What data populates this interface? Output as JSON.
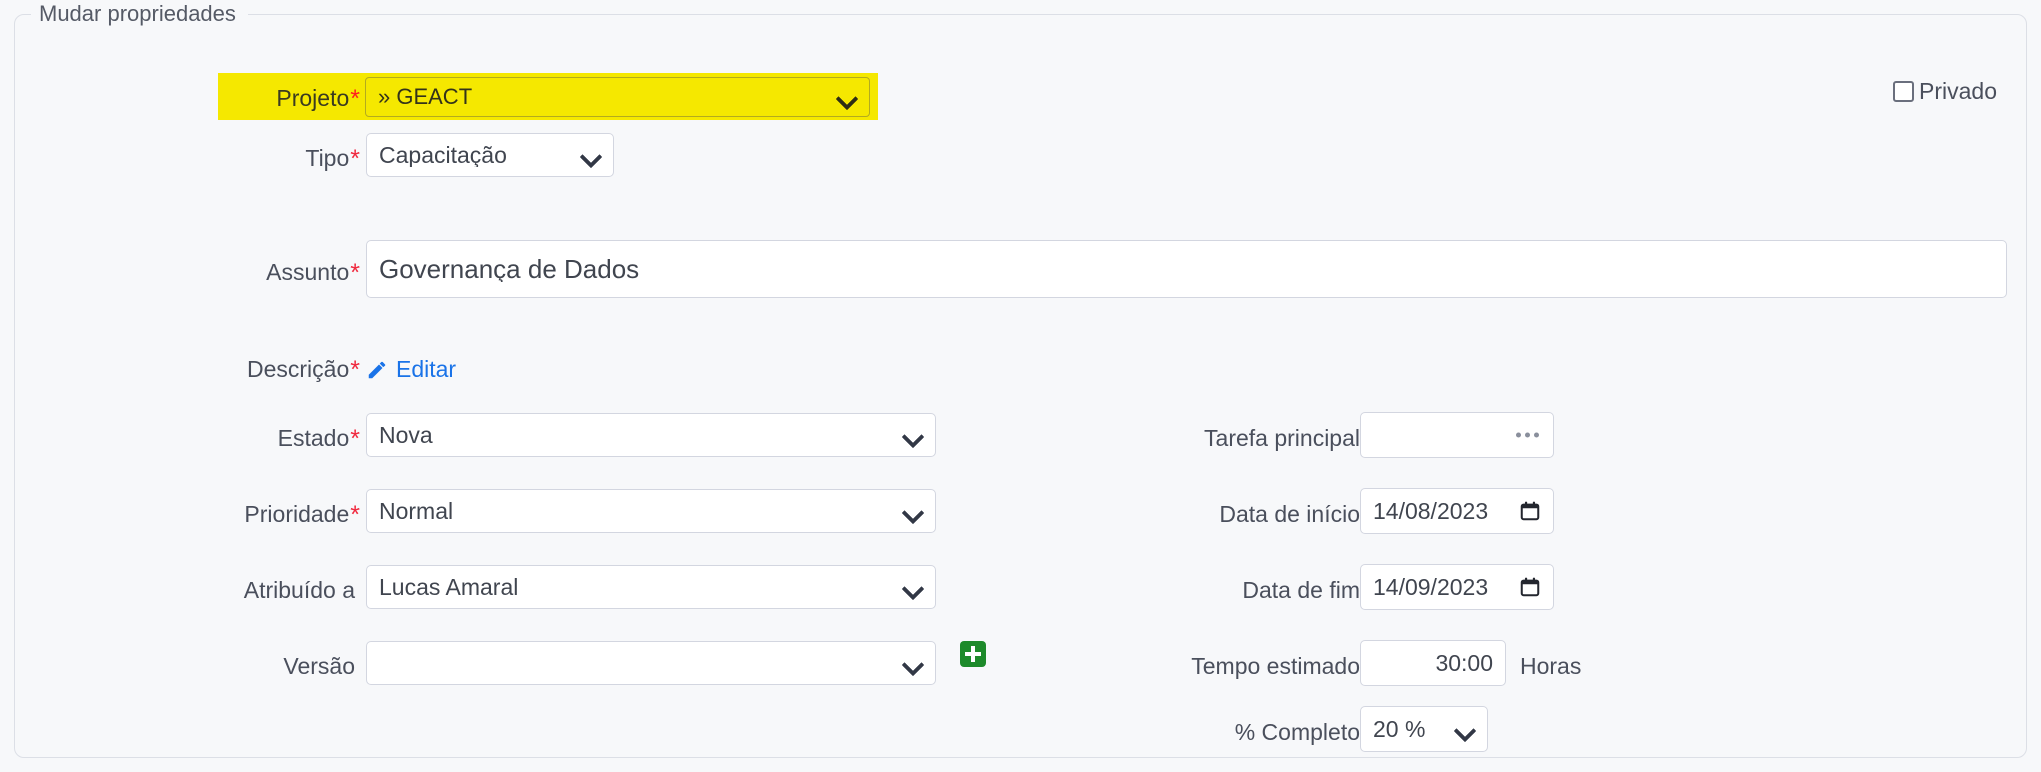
{
  "fieldset": {
    "legend": "Mudar propriedades"
  },
  "form": {
    "projeto": {
      "label": "Projeto",
      "required": true,
      "value": "» GEACT",
      "highlight_color": "#f5e800"
    },
    "tipo": {
      "label": "Tipo",
      "required": true,
      "value": "Capacitação"
    },
    "assunto": {
      "label": "Assunto",
      "required": true,
      "value": "Governança de Dados"
    },
    "descricao": {
      "label": "Descrição",
      "required": true,
      "edit_link": "Editar",
      "edit_icon": "pencil-icon",
      "link_color": "#1a73e8"
    },
    "estado": {
      "label": "Estado",
      "required": true,
      "value": "Nova"
    },
    "prioridade": {
      "label": "Prioridade",
      "required": true,
      "value": "Normal"
    },
    "atribuido_a": {
      "label": "Atribuído a",
      "required": false,
      "value": "Lucas Amaral"
    },
    "versao": {
      "label": "Versão",
      "required": false,
      "value": "",
      "add_button_icon": "plus-icon",
      "add_button_color": "#1d8a2a"
    },
    "tarefa_principal": {
      "label": "Tarefa principal",
      "required": false,
      "value": "",
      "affordance_icon": "ellipsis-icon"
    },
    "data_inicio": {
      "label": "Data de início",
      "required": false,
      "value": "14/08/2023",
      "icon": "calendar-icon"
    },
    "data_fim": {
      "label": "Data de fim",
      "required": false,
      "value": "14/09/2023",
      "icon": "calendar-icon"
    },
    "tempo_estimado": {
      "label": "Tempo estimado",
      "required": false,
      "value": "30:00",
      "unit": "Horas"
    },
    "percent_completo": {
      "label": "% Completo",
      "required": false,
      "value": "20 %"
    },
    "privado": {
      "label": "Privado",
      "checked": false
    }
  },
  "markers": {
    "required_asterisk": "*",
    "required_color": "#f0293e"
  }
}
